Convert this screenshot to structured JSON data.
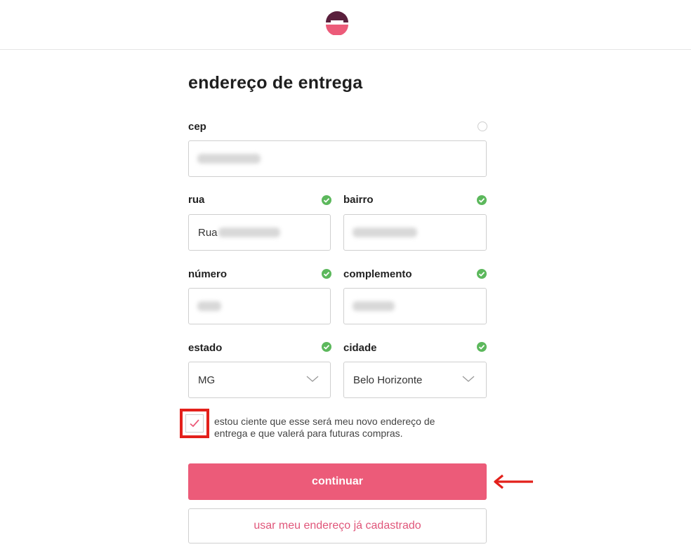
{
  "brand": {
    "logo_icon": "e-logo-icon",
    "accent_color": "#ec5b79",
    "logo_top_color": "#5a1f3c"
  },
  "page": {
    "title": "endereço de entrega"
  },
  "form": {
    "cep": {
      "label": "cep",
      "value": "30180-370",
      "status": "pending"
    },
    "rua": {
      "label": "rua",
      "value_prefix": "Rua",
      "value": "dos Aimorés",
      "status": "ok"
    },
    "bairro": {
      "label": "bairro",
      "value": "Boa Viagem",
      "status": "ok"
    },
    "numero": {
      "label": "número",
      "value": "1536",
      "status": "ok"
    },
    "complemento": {
      "label": "complemento",
      "value": "apt 902",
      "status": "ok"
    },
    "estado": {
      "label": "estado",
      "selected": "MG",
      "status": "ok"
    },
    "cidade": {
      "label": "cidade",
      "selected": "Belo Horizonte",
      "status": "ok"
    }
  },
  "consent": {
    "checked": true,
    "text": "estou ciente que esse será meu novo endereço de entrega e que valerá para futuras compras."
  },
  "actions": {
    "continue_label": "continuar",
    "use_saved_label": "usar meu endereço já cadastrado"
  },
  "annotation": {
    "highlight_color": "#e3201b"
  }
}
